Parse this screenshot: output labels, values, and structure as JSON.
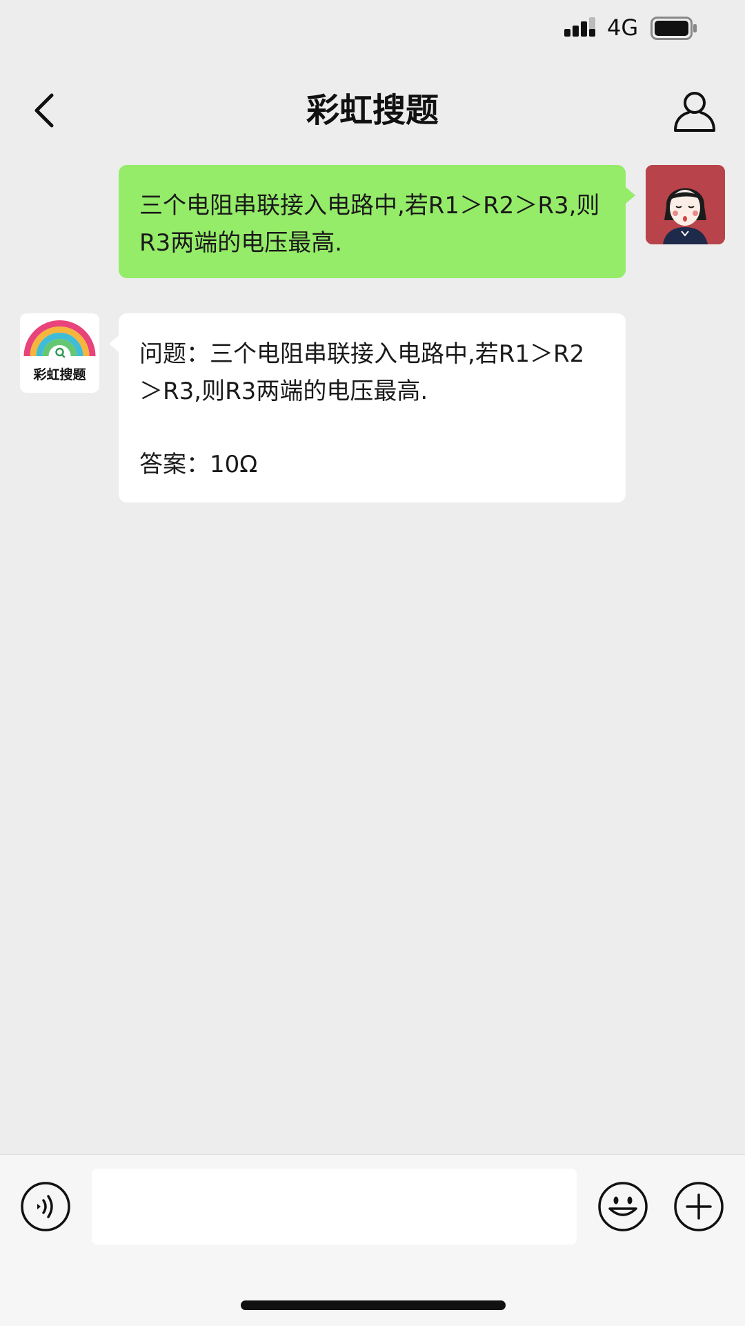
{
  "status_bar": {
    "network": "4G"
  },
  "header": {
    "title": "彩虹搜题"
  },
  "messages": {
    "user": {
      "text": "三个电阻串联接入电路中,若R1＞R2＞R3,则R3两端的电压最高."
    },
    "bot": {
      "question": "问题：三个电阻串联接入电路中,若R1＞R2＞R3,则R3两端的电压最高.",
      "answer": "答案：10Ω",
      "logo_text": "彩虹搜题"
    }
  },
  "input_bar": {
    "placeholder": ""
  },
  "colors": {
    "background": "#ededed",
    "user_bubble": "#95ec69",
    "bot_bubble": "#ffffff",
    "user_avatar_bg": "#b9434a"
  }
}
